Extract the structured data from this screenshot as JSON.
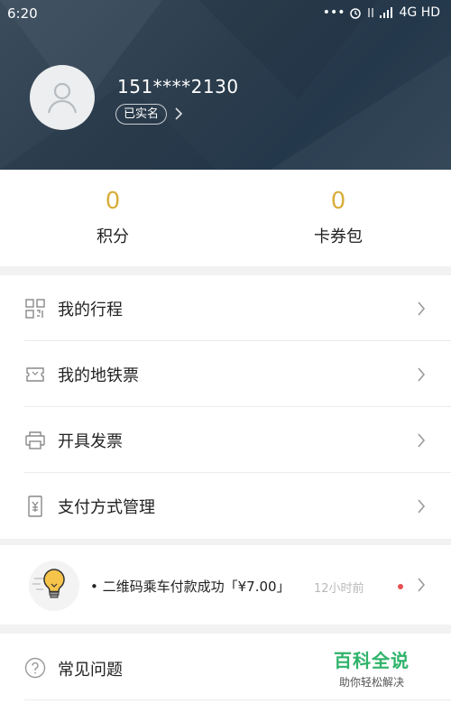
{
  "status_bar": {
    "time": "6:20",
    "network": "4G HD"
  },
  "profile": {
    "phone": "151****2130",
    "verified_label": "已实名"
  },
  "stats": [
    {
      "value": "0",
      "label": "积分"
    },
    {
      "value": "0",
      "label": "卡券包"
    }
  ],
  "menu": [
    {
      "label": "我的行程",
      "icon": "qr-grid-icon"
    },
    {
      "label": "我的地铁票",
      "icon": "ticket-icon"
    },
    {
      "label": "开具发票",
      "icon": "printer-icon"
    },
    {
      "label": "支付方式管理",
      "icon": "yen-card-icon"
    }
  ],
  "notice": {
    "message": "二维码乘车付款成功「¥7.00」",
    "time": "12小时前",
    "icon": "lightbulb-icon"
  },
  "faq": {
    "label": "常见问题",
    "icon": "question-circle-icon"
  },
  "watermark": {
    "title": "百科全说",
    "subtitle": "助你轻松解决"
  },
  "colors": {
    "header_bg": "#2c3d4d",
    "stat_value": "#d8ae3c",
    "watermark": "#2fb36a",
    "unread_dot": "#e84f4f"
  }
}
